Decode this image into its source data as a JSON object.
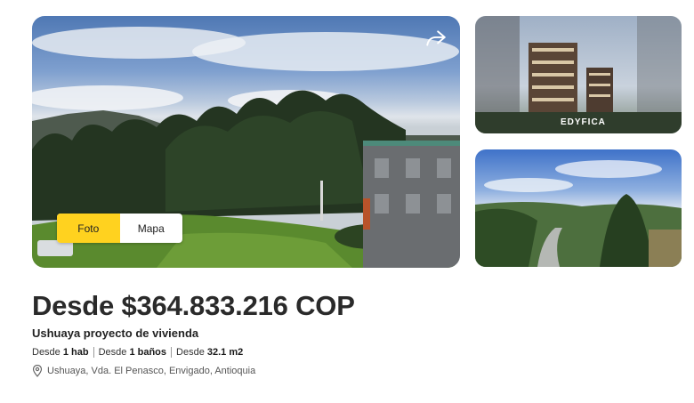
{
  "gallery": {
    "toggle": {
      "photo_label": "Foto",
      "map_label": "Mapa",
      "active": "Foto"
    },
    "brand_watermark": "EDYFICA",
    "accent_color": "#ffd21f"
  },
  "listing": {
    "price": "Desde $364.833.216 COP",
    "name": "Ushuaya proyecto de vivienda",
    "features": [
      {
        "prefix": "Desde",
        "value": "1 hab"
      },
      {
        "prefix": "Desde",
        "value": "1 baños"
      },
      {
        "prefix": "Desde",
        "value": "32.1 m2"
      }
    ],
    "location": "Ushuaya, Vda. El Penasco, Envigado, Antioquia"
  }
}
